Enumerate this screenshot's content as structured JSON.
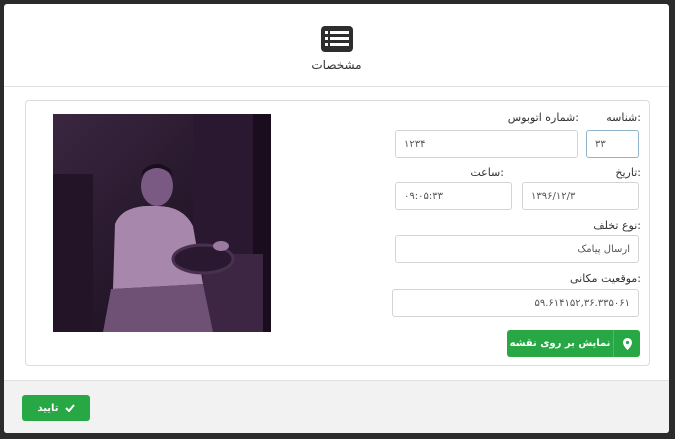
{
  "dialog": {
    "title": "مشخصات",
    "header_icon": "list-card-icon"
  },
  "form": {
    "id_label": "شناسه:",
    "id_value": "۳۳",
    "bus_number_label": "شماره اتوبوس:",
    "bus_number_value": "۱۲۳۴",
    "date_label": "تاریخ:",
    "date_value": "۱۳۹۶/۱۲/۳",
    "time_label": "ساعت:",
    "time_value": "۰۹:۰۵:۳۳",
    "violation_type_label": "نوع تخلف:",
    "violation_type_value": "ارسال پیامک",
    "location_label": "موقعیت مکانی:",
    "location_value": "۵۹.۶۱۴۱۵۲,۳۶.۳۳۵۰۶۱",
    "map_button_label": "نمایش بر روی نقشه",
    "map_button_icon": "map-marker-icon"
  },
  "photo": {
    "description_icon": "driver-photo"
  },
  "footer": {
    "confirm_label": "تایید",
    "confirm_icon": "check-icon"
  },
  "colors": {
    "success": "#28a745",
    "photo_tint": "#6a3d7a"
  }
}
